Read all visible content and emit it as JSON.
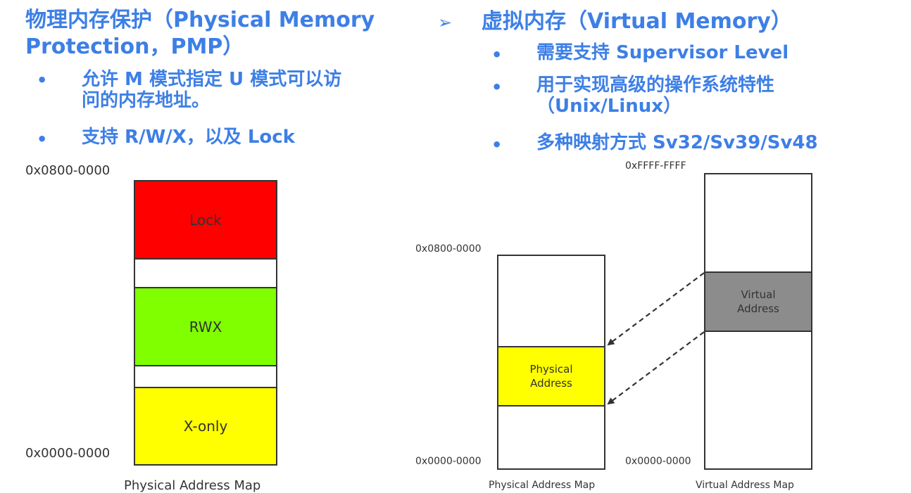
{
  "left": {
    "heading": "物理内存保护（Physical Memory Protection，PMP）",
    "heading_line1": "物理内存保护（Physical Memory",
    "heading_line2": "Protection，PMP）",
    "bullets": [
      {
        "line1": "允许 M 模式指定 U 模式可以访",
        "line2": "问的内存地址。"
      },
      {
        "line1": "支持 R/W/X，以及 Lock",
        "line2": ""
      }
    ],
    "diagram": {
      "top_address": "0x0800-0000",
      "bottom_address": "0x0000-0000",
      "caption": "Physical Address Map",
      "regions": [
        {
          "label": "Lock",
          "color": "#ff0000"
        },
        {
          "label": "",
          "color": "#ffffff"
        },
        {
          "label": "RWX",
          "color": "#7fff00"
        },
        {
          "label": "",
          "color": "#ffffff"
        },
        {
          "label": "X-only",
          "color": "#ffff00"
        }
      ]
    }
  },
  "right": {
    "arrow_glyph": "➢",
    "heading": "虚拟内存（Virtual Memory）",
    "bullets": [
      {
        "line1": "需要支持 Supervisor Level",
        "line2": ""
      },
      {
        "line1": "用于实现高级的操作系统特性",
        "line2": "（Unix/Linux）"
      },
      {
        "line1": "多种映射方式 Sv32/Sv39/Sv48",
        "line2": ""
      }
    ],
    "physical_map": {
      "top_address": "0x0800-0000",
      "bottom_address": "0x0000-0000",
      "region_label": "Physical Address",
      "region_color": "#ffff00",
      "caption": "Physical Address Map"
    },
    "virtual_map": {
      "top_address": "0xFFFF-FFFF",
      "bottom_address": "0x0000-0000",
      "region_label": "Virtual Address",
      "region_color": "#8c8c8c",
      "caption": "Virtual Address Map"
    }
  },
  "bullet_glyph": "•",
  "colors": {
    "heading": "#3d7fe6",
    "outline": "#333333"
  }
}
